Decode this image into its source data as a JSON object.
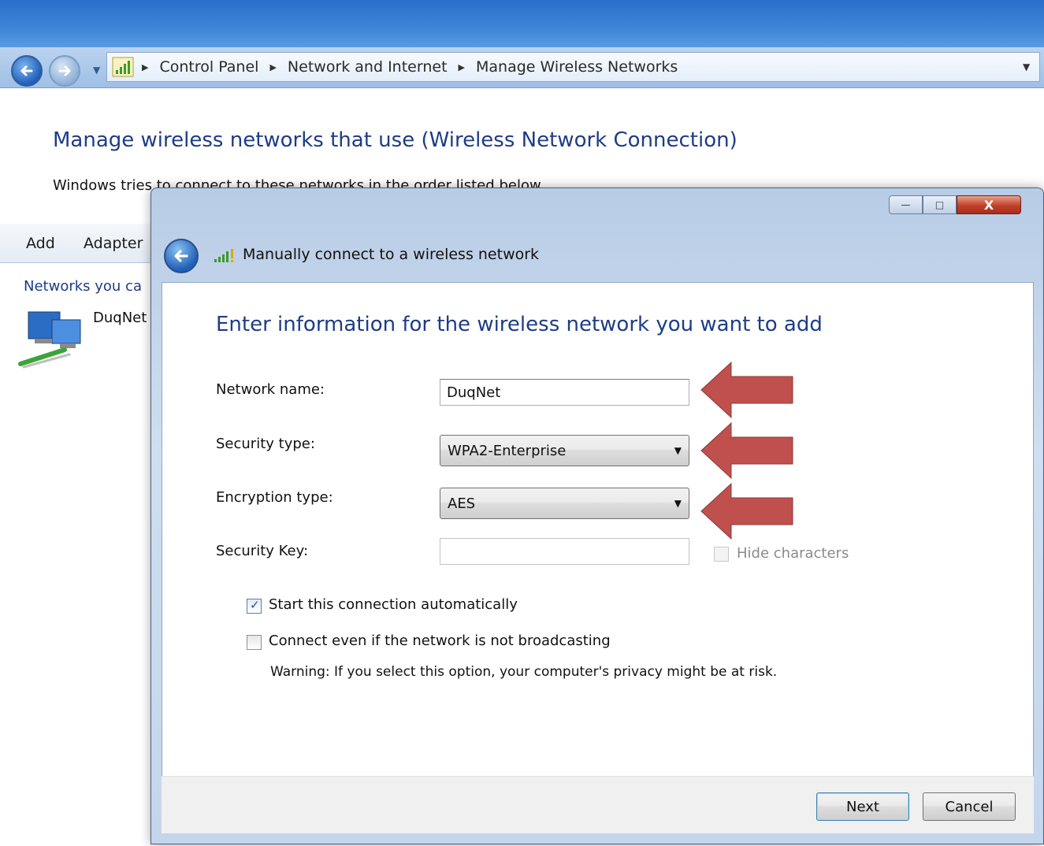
{
  "explorer": {
    "breadcrumbs": [
      "Control Panel",
      "Network and Internet",
      "Manage Wireless Networks"
    ],
    "heading": "Manage wireless networks that use (Wireless Network Connection)",
    "description": "Windows tries to connect to these networks in the order listed below.",
    "toolbar": {
      "add_label": "Add",
      "adapter_label": "Adapter"
    },
    "networks_label": "Networks you ca",
    "network_name": "DuqNet"
  },
  "dialog": {
    "title": "Manually connect to a wireless network",
    "window_controls": {
      "minimize": "—",
      "maximize": "□",
      "close": "X"
    },
    "heading": "Enter information for the wireless network you want to add",
    "fields": {
      "network_name_label": "Network name:",
      "network_name_value": "DuqNet",
      "security_type_label": "Security type:",
      "security_type_value": "WPA2-Enterprise",
      "encryption_type_label": "Encryption type:",
      "encryption_type_value": "AES",
      "security_key_label": "Security Key:",
      "security_key_value": "",
      "hide_characters_label": "Hide characters"
    },
    "options": {
      "start_automatically_label": "Start this connection automatically",
      "start_automatically_checked": true,
      "connect_not_broadcasting_label": "Connect even if the network is not broadcasting",
      "connect_not_broadcasting_checked": false,
      "warning": "Warning: If you select this option, your computer's privacy might be at risk."
    },
    "buttons": {
      "next": "Next",
      "cancel": "Cancel"
    }
  },
  "annotations": {
    "arrow_color": "#c0504d"
  },
  "colors": {
    "heading_blue": "#1e3c87",
    "titlebar_blue": "#2a6fc9"
  }
}
